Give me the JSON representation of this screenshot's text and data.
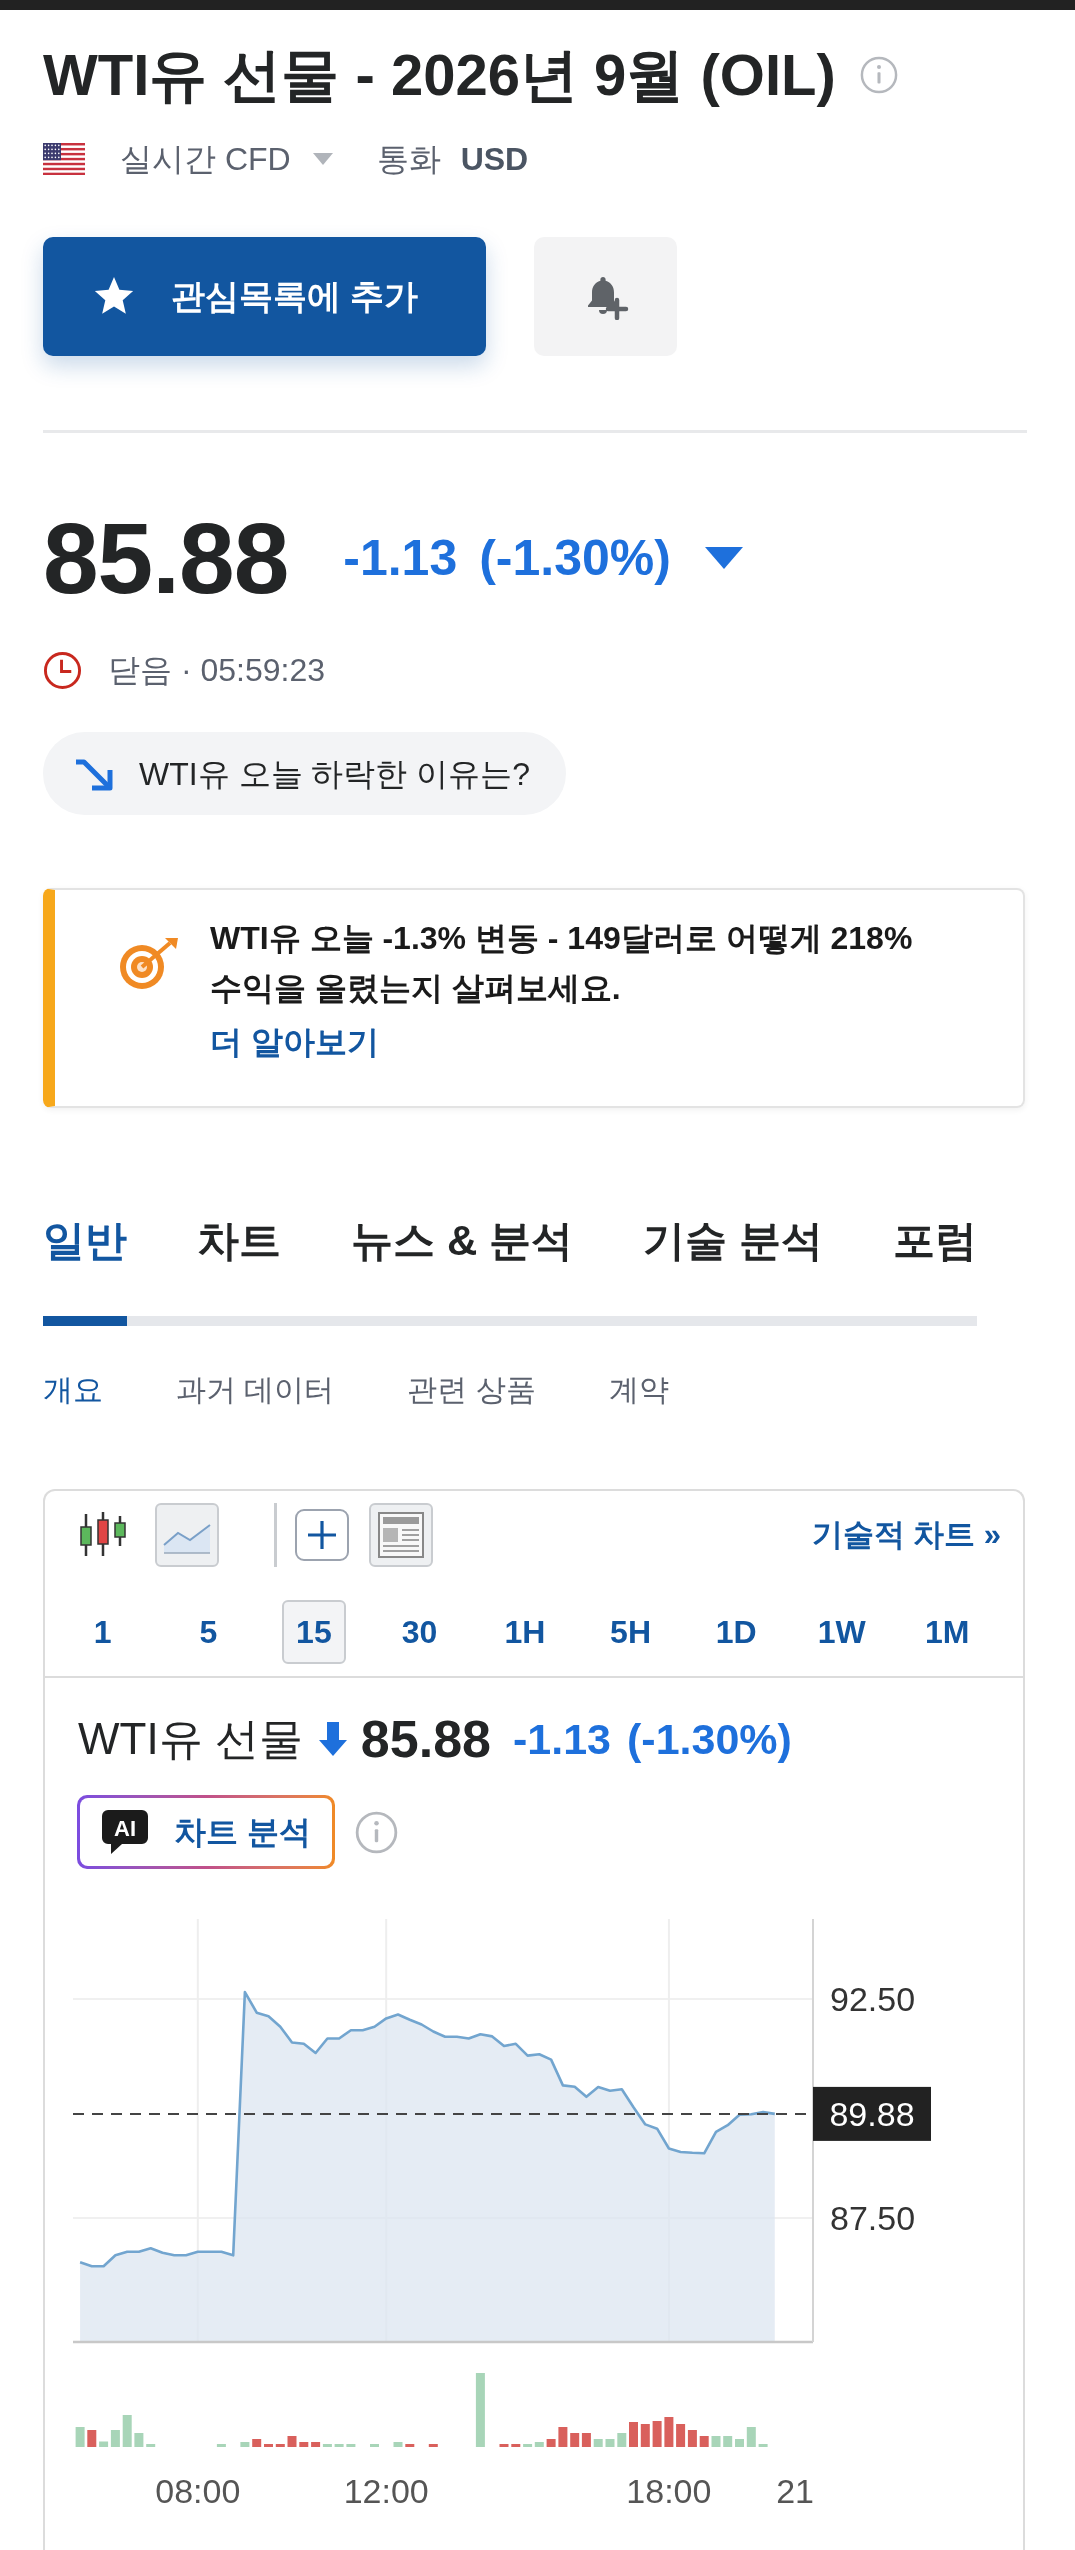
{
  "header": {
    "title": "WTI유 선물 - 2026년 9월 (OIL)",
    "market_type": "실시간 CFD",
    "currency_label": "통화",
    "currency": "USD"
  },
  "actions": {
    "watchlist_button": "관심목록에 추가"
  },
  "quote": {
    "price": "85.88",
    "change": "-1.13",
    "change_percent": "(-1.30%)",
    "negative": true,
    "status": "닫음 · 05:59:23"
  },
  "why_button": "WTI유 오늘 하락한 이유는?",
  "promo": {
    "text": "WTI유 오늘 -1.3% 변동 - 149달러로 어떻게 218% 수익을 올렸는지 살펴보세요.",
    "link": "더 알아보기"
  },
  "tabs": [
    {
      "label": "일반",
      "selected": true
    },
    {
      "label": "차트",
      "selected": false
    },
    {
      "label": "뉴스 & 분석",
      "selected": false
    },
    {
      "label": "기술 분석",
      "selected": false
    },
    {
      "label": "포럼",
      "selected": false
    }
  ],
  "subtabs": [
    {
      "label": "개요",
      "selected": true
    },
    {
      "label": "과거 데이터",
      "selected": false
    },
    {
      "label": "관련 상품",
      "selected": false
    },
    {
      "label": "계약",
      "selected": false
    }
  ],
  "chart_widget": {
    "chart_types": [
      {
        "kind": "candlestick",
        "selected": false
      },
      {
        "kind": "line",
        "selected": true
      }
    ],
    "technical_chart_link": "기술적 차트 »",
    "intervals": [
      {
        "label": "1",
        "selected": false
      },
      {
        "label": "5",
        "selected": false
      },
      {
        "label": "15",
        "selected": true
      },
      {
        "label": "30",
        "selected": false
      },
      {
        "label": "1H",
        "selected": false
      },
      {
        "label": "5H",
        "selected": false
      },
      {
        "label": "1D",
        "selected": false
      },
      {
        "label": "1W",
        "selected": false
      },
      {
        "label": "1M",
        "selected": false
      }
    ],
    "instrument": {
      "name": "WTI유 선물",
      "negative": true,
      "price": "85.88",
      "change": "-1.13",
      "change_percent": "(-1.30%)"
    },
    "ai_button": {
      "badge": "AI",
      "label": "차트 분석"
    },
    "chart_data": {
      "type": "area",
      "x": [
        5.5,
        5.75,
        6,
        6.25,
        6.5,
        6.75,
        7,
        7.25,
        7.5,
        7.75,
        8,
        8.25,
        8.5,
        8.75,
        9,
        9.25,
        9.5,
        9.75,
        10,
        10.25,
        10.5,
        10.75,
        11,
        11.25,
        11.5,
        11.75,
        12,
        12.25,
        12.5,
        12.75,
        13,
        13.25,
        13.5,
        13.75,
        14,
        14.25,
        14.5,
        14.75,
        15,
        15.25,
        15.5,
        15.75,
        16,
        16.25,
        16.5,
        16.75,
        17,
        17.25,
        17.5,
        17.75,
        18,
        18.25,
        18.5,
        18.75,
        19,
        19.25,
        19.5,
        19.75,
        20,
        20.25
      ],
      "values": [
        86.49,
        86.4,
        86.4,
        86.65,
        86.73,
        86.73,
        86.81,
        86.71,
        86.65,
        86.65,
        86.73,
        86.73,
        86.73,
        86.65,
        92.66,
        92.19,
        92.11,
        91.87,
        91.51,
        91.48,
        91.27,
        91.6,
        91.6,
        91.79,
        91.79,
        91.87,
        92.06,
        92.15,
        92.03,
        91.92,
        91.76,
        91.64,
        91.64,
        91.6,
        91.7,
        91.65,
        91.43,
        91.48,
        91.21,
        91.24,
        91.12,
        90.53,
        90.5,
        90.27,
        90.49,
        90.41,
        90.44,
        90.03,
        89.64,
        89.54,
        89.09,
        89.01,
        88.99,
        88.98,
        89.47,
        89.62,
        89.86,
        89.87,
        89.92,
        89.88
      ],
      "xlim": [
        5.35,
        21.06
      ],
      "ylim": [
        84.67,
        94.33
      ],
      "xticks": [
        {
          "value": 8,
          "label": "08:00"
        },
        {
          "value": 12,
          "label": "12:00"
        },
        {
          "value": 18,
          "label": "18:00"
        },
        {
          "value": 21,
          "label": "21"
        }
      ],
      "yticks": [
        {
          "value": 92.5,
          "label": "92.50"
        },
        {
          "value": 87.5,
          "label": "87.50"
        }
      ],
      "grid": true,
      "ref_lines": [
        {
          "axis": "y",
          "value": 89.88,
          "label": "89.88"
        }
      ]
    }
  }
}
